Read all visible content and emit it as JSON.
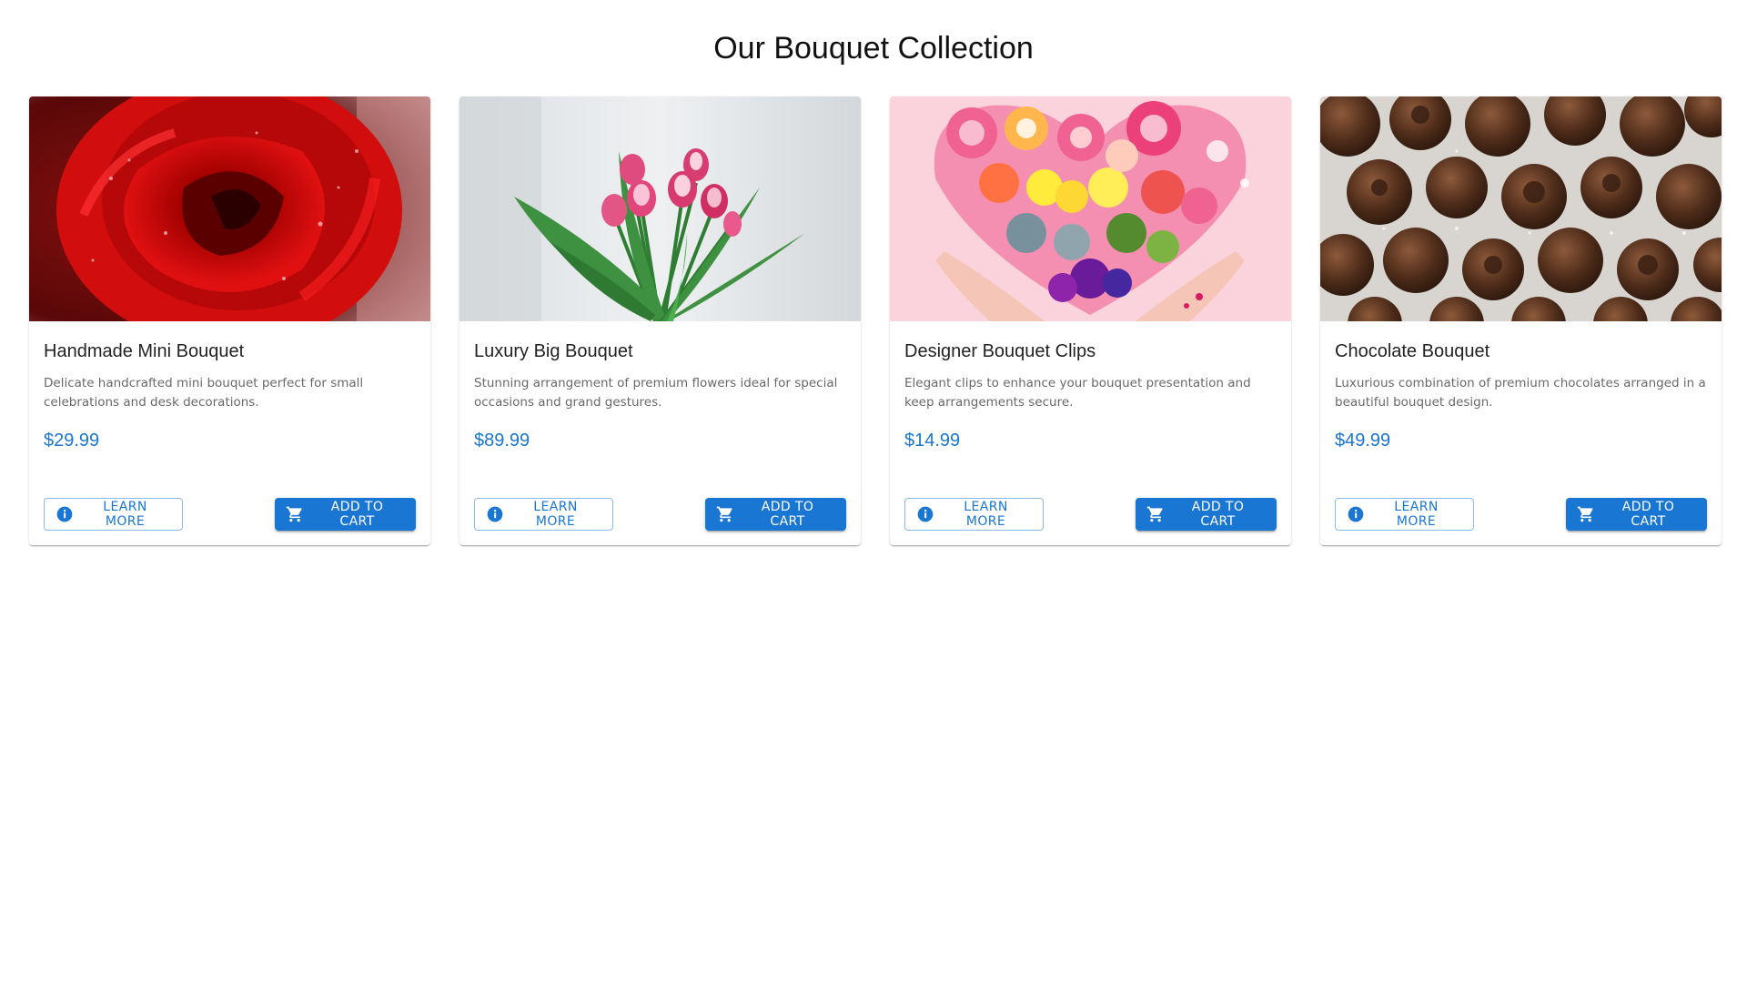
{
  "page": {
    "title": "Our Bouquet Collection"
  },
  "colors": {
    "primary": "#1976d2",
    "price": "#1976d2"
  },
  "products": [
    {
      "name": "Handmade Mini Bouquet",
      "description": "Delicate handcrafted mini bouquet perfect for small celebrations and desk decorations.",
      "price": "$29.99",
      "image": "red-rose-photo",
      "learn_more_label": "LEARN MORE",
      "add_to_cart_label": "ADD TO CART"
    },
    {
      "name": "Luxury Big Bouquet",
      "description": "Stunning arrangement of premium flowers ideal for special occasions and grand gestures.",
      "price": "$89.99",
      "image": "pink-tulips-photo",
      "learn_more_label": "LEARN MORE",
      "add_to_cart_label": "ADD TO CART"
    },
    {
      "name": "Designer Bouquet Clips",
      "description": "Elegant clips to enhance your bouquet presentation and keep arrangements secure.",
      "price": "$14.99",
      "image": "heart-flowers-hands-photo",
      "learn_more_label": "LEARN MORE",
      "add_to_cart_label": "ADD TO CART"
    },
    {
      "name": "Chocolate Bouquet",
      "description": "Luxurious combination of premium chocolates arranged in a beautiful bouquet design.",
      "price": "$49.99",
      "image": "chocolate-truffles-photo",
      "learn_more_label": "LEARN MORE",
      "add_to_cart_label": "ADD TO CART"
    }
  ],
  "icons": {
    "learn_more": "info-icon",
    "add_to_cart": "cart-icon"
  }
}
